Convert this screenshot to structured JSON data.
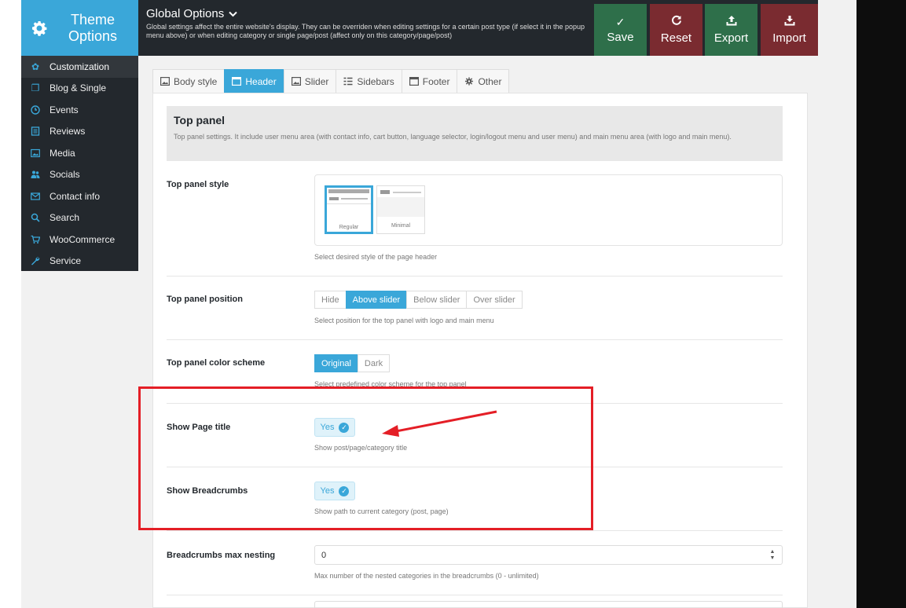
{
  "brand": {
    "title": "Theme Options"
  },
  "sidebar": {
    "items": [
      {
        "label": "Customization",
        "icon": "gear-icon"
      },
      {
        "label": "Blog & Single",
        "icon": "blog-icon"
      },
      {
        "label": "Events",
        "icon": "clock-icon"
      },
      {
        "label": "Reviews",
        "icon": "list-icon"
      },
      {
        "label": "Media",
        "icon": "image-icon"
      },
      {
        "label": "Socials",
        "icon": "users-icon"
      },
      {
        "label": "Contact info",
        "icon": "envelope-icon"
      },
      {
        "label": "Search",
        "icon": "search-icon"
      },
      {
        "label": "WooCommerce",
        "icon": "cart-icon"
      },
      {
        "label": "Service",
        "icon": "wrench-icon"
      }
    ]
  },
  "topbar": {
    "title": "Global Options",
    "description": "Global settings affect the entire website's display. They can be overriden when editing settings for a certain post type (if select it in the popup menu above) or when editing category or single page/post (affect only on this category/page/post)",
    "buttons": {
      "save": "Save",
      "reset": "Reset",
      "export": "Export",
      "import": "Import"
    }
  },
  "tabs": [
    "Body style",
    "Header",
    "Slider",
    "Sidebars",
    "Footer",
    "Other"
  ],
  "section": {
    "title": "Top panel",
    "description": "Top panel settings. It include user menu area (with contact info, cart button, language selector, login/logout menu and user menu) and main menu area (with logo and main menu)."
  },
  "settings": {
    "style": {
      "label": "Top panel style",
      "options": [
        "Regular",
        "Minimal"
      ],
      "selected": "Regular",
      "desc": "Select desired style of the page header"
    },
    "position": {
      "label": "Top panel position",
      "options": [
        "Hide",
        "Above slider",
        "Below slider",
        "Over slider"
      ],
      "selected": "Above slider",
      "desc": "Select position for the top panel with logo and main menu"
    },
    "scheme": {
      "label": "Top panel color scheme",
      "options": [
        "Original",
        "Dark"
      ],
      "selected": "Original",
      "desc": "Select predefined color scheme for the top panel"
    },
    "page_title": {
      "label": "Show Page title",
      "value": "Yes",
      "desc": "Show post/page/category title"
    },
    "breadcrumbs": {
      "label": "Show Breadcrumbs",
      "value": "Yes",
      "desc": "Show path to current category (post, page)"
    },
    "nesting": {
      "label": "Breadcrumbs max nesting",
      "value": "0",
      "desc": "Max number of the nested categories in the breadcrumbs (0 - unlimited)"
    }
  },
  "colors": {
    "accent": "#3aa7d9",
    "save": "#2e6f4a",
    "reset": "#7a2b30",
    "export": "#2e6f4a",
    "import": "#7a2b30",
    "dark": "#23282d",
    "highlight": "#e41e26"
  }
}
